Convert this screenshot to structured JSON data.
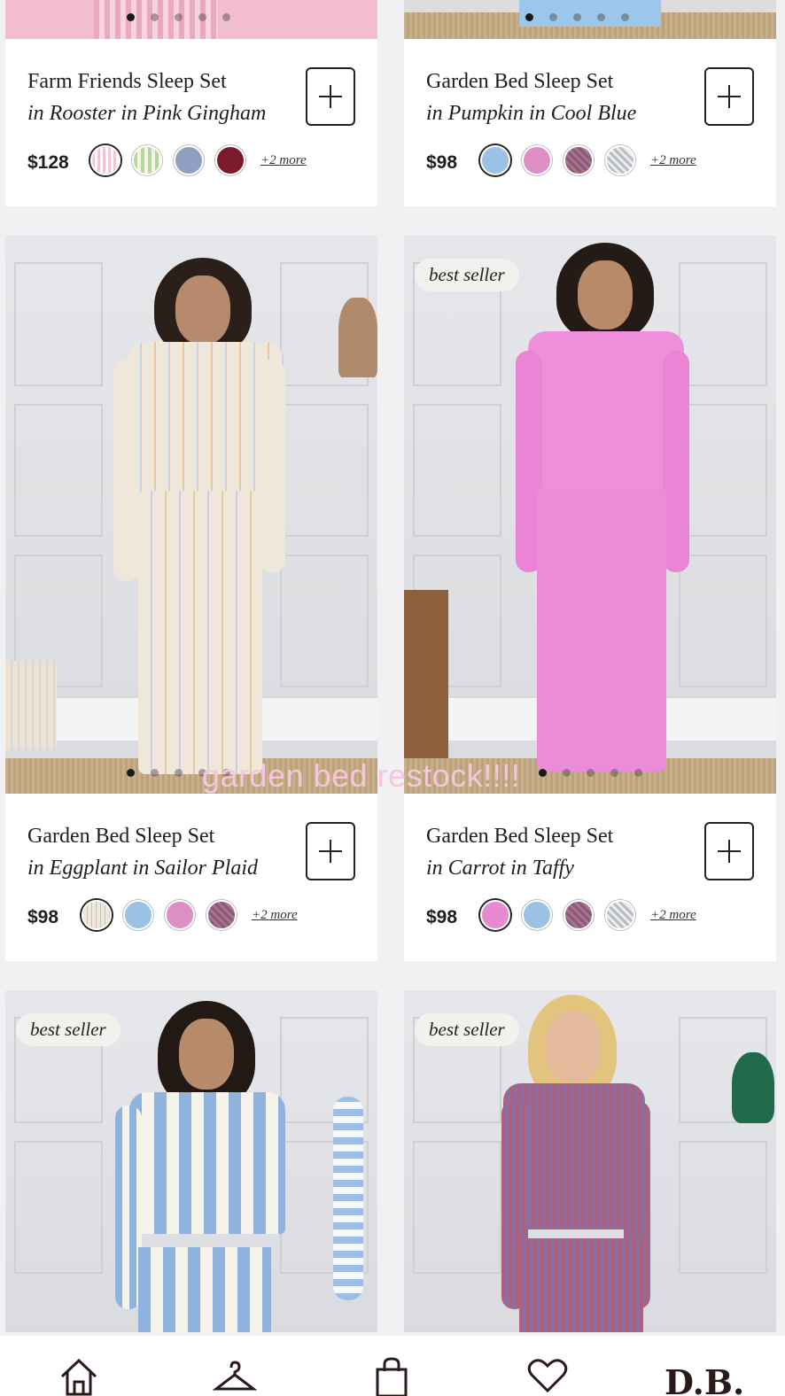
{
  "overlay_caption": "garden bed restock!!!!",
  "products": [
    {
      "title": "Farm Friends Sleep Set",
      "variant": "in Rooster in Pink Gingham",
      "price": "$128",
      "more": "+2 more",
      "badge": "",
      "swatches": [
        "#f2c6d4",
        "#cfe3b8",
        "#8fa0c4",
        "#7a1a2c"
      ],
      "outfit_color": "#f4c3d6"
    },
    {
      "title": "Garden Bed Sleep Set",
      "variant": "in Pumpkin in Cool Blue",
      "price": "$98",
      "more": "+2 more",
      "badge": "",
      "swatches": [
        "#9bc1e4",
        "#dd8fc6",
        "#8c5a76",
        "#c9ccd0"
      ],
      "outfit_color": "#9cc6ea"
    },
    {
      "title": "Garden Bed Sleep Set",
      "variant": "in Eggplant in Sailor Plaid",
      "price": "$98",
      "more": "+2 more",
      "badge": "",
      "swatches": [
        "#ede7dc",
        "#9bc1e4",
        "#dd8fc6",
        "#8c5a76"
      ],
      "outfit_color": "#efe7da"
    },
    {
      "title": "Garden Bed Sleep Set",
      "variant": "in Carrot in Taffy",
      "price": "$98",
      "more": "+2 more",
      "badge": "best seller",
      "swatches": [
        "#e58ad3",
        "#9bc1e4",
        "#8c5a76",
        "#c9ccd0"
      ],
      "outfit_color": "#ee8fdb"
    },
    {
      "title": "",
      "variant": "",
      "price": "",
      "more": "",
      "badge": "best seller",
      "swatches": [],
      "outfit_color": "#8fb3dd"
    },
    {
      "title": "",
      "variant": "",
      "price": "",
      "more": "",
      "badge": "best seller",
      "swatches": [],
      "outfit_color": "#b0607f"
    }
  ],
  "nav": {
    "items": [
      "home-icon",
      "hanger-icon",
      "bag-icon",
      "heart-icon"
    ],
    "brand": "D.B."
  }
}
